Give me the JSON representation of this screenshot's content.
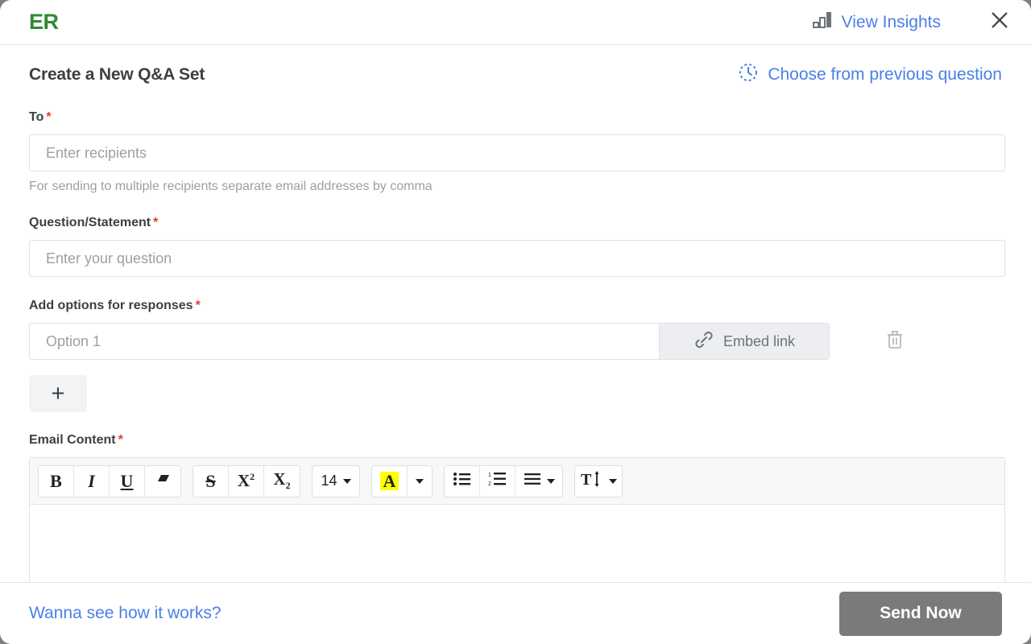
{
  "header": {
    "logo": "ER",
    "insights_label": "View Insights",
    "insights_icon": "bar-chart-icon",
    "close_icon": "close-icon",
    "link_color": "#4a7fe8",
    "logo_color": "#2e8b31"
  },
  "main": {
    "title": "Create a New Q&A Set",
    "prev_question_label": "Choose from previous question",
    "prev_question_icon": "history-clock-icon",
    "required_marker": "*",
    "required_color": "#e03c31",
    "fields": {
      "to": {
        "label": "To",
        "placeholder": "Enter recipients",
        "value": "",
        "hint": "For sending to multiple recipients separate email addresses by comma"
      },
      "question": {
        "label": "Question/Statement",
        "placeholder": "Enter your question",
        "value": ""
      },
      "options": {
        "label": "Add options for responses",
        "items": [
          {
            "placeholder": "Option 1",
            "value": "",
            "embed_label": "Embed link",
            "embed_icon": "link-icon",
            "delete_icon": "trash-icon"
          }
        ],
        "add_label": "+",
        "add_icon": "plus-icon"
      },
      "email_content": {
        "label": "Email Content",
        "value": ""
      }
    }
  },
  "toolbar": {
    "groups": [
      {
        "buttons": [
          {
            "name": "bold",
            "glyph": "B"
          },
          {
            "name": "italic",
            "glyph": "I"
          },
          {
            "name": "underline",
            "glyph": "U"
          },
          {
            "name": "clear-format",
            "glyph": ""
          }
        ]
      },
      {
        "buttons": [
          {
            "name": "strikethrough",
            "glyph": "S"
          },
          {
            "name": "superscript",
            "glyph": "X"
          },
          {
            "name": "subscript",
            "glyph": "X"
          }
        ]
      },
      {
        "buttons": [
          {
            "name": "font-size",
            "glyph": "14"
          }
        ]
      },
      {
        "buttons": [
          {
            "name": "highlight-color",
            "glyph": "A"
          },
          {
            "name": "highlight-dropdown",
            "glyph": ""
          }
        ]
      },
      {
        "buttons": [
          {
            "name": "bullet-list",
            "glyph": ""
          },
          {
            "name": "numbered-list",
            "glyph": ""
          },
          {
            "name": "align",
            "glyph": ""
          }
        ]
      },
      {
        "buttons": [
          {
            "name": "line-height",
            "glyph": "T"
          }
        ]
      }
    ],
    "font_size_value": "14",
    "highlight_color": "#ffff00",
    "superscript_value": "2",
    "subscript_value": "2"
  },
  "footer": {
    "help_link": "Wanna see how it works?",
    "send_label": "Send Now",
    "send_bg": "#7a7a7a"
  }
}
